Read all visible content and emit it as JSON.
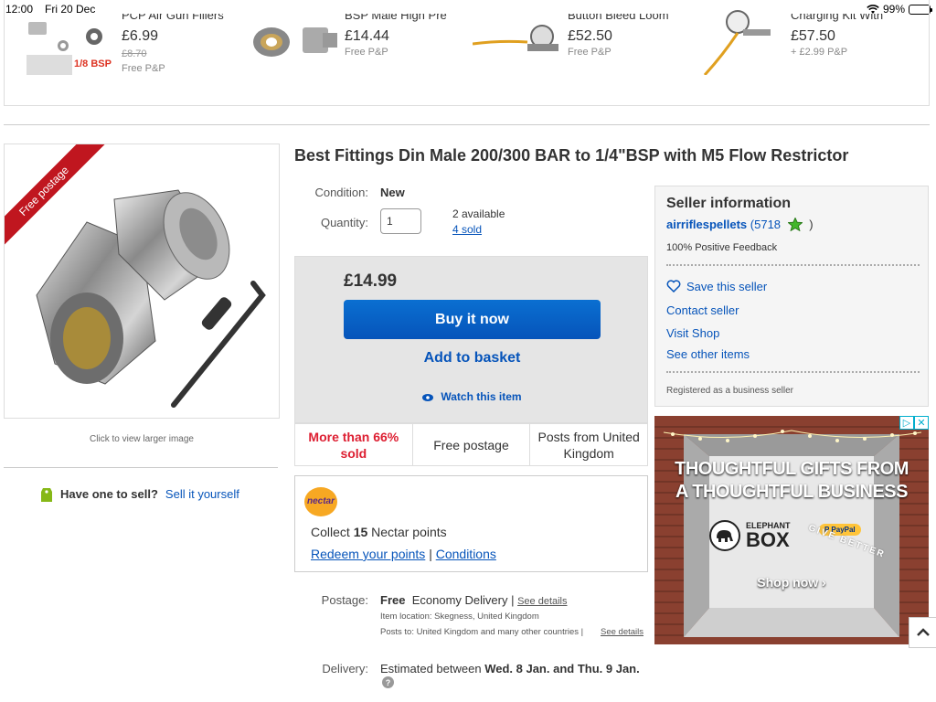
{
  "status_bar": {
    "time": "12:00",
    "date": "Fri 20 Dec",
    "battery": "99%",
    "battery_level": 0.99
  },
  "carousel": {
    "items": [
      {
        "title": "PCP Air Gun Fillers",
        "price": "£6.99",
        "was_price": "£8.70",
        "postage": "Free P&P",
        "thumb_label": "1/8 BSP"
      },
      {
        "title": "BSP Male High Pre",
        "price": "£14.44",
        "postage": "Free P&P"
      },
      {
        "title": "Button Bleed Loom",
        "price": "£52.50",
        "postage": "Free P&P"
      },
      {
        "title": "Charging Kit With",
        "price": "£57.50",
        "postage": "+ £2.99 P&P"
      }
    ]
  },
  "listing": {
    "ribbon": "Free postage",
    "click_larger": "Click to view larger image",
    "sell": {
      "question": "Have one to sell?",
      "link": "Sell it yourself"
    },
    "title": "Best Fittings Din Male 200/300 BAR to 1/4\"BSP with M5 Flow Restrictor",
    "condition_label": "Condition:",
    "condition": "New",
    "quantity_label": "Quantity:",
    "quantity_value": "1",
    "available": "2 available",
    "sold_link": "4 sold",
    "price": "£14.99",
    "buy_now": "Buy it now",
    "add_basket": "Add to basket",
    "watch": "Watch this item",
    "features": {
      "sold": "More than 66% sold",
      "postage": "Free postage",
      "posts_from": "Posts from United Kingdom"
    }
  },
  "nectar": {
    "logo": "nectar",
    "collect_prefix": "Collect",
    "points": "15",
    "collect_suffix": "Nectar points",
    "redeem": "Redeem your points",
    "separator": "|",
    "conditions": "Conditions"
  },
  "shipping": {
    "postage_label": "Postage:",
    "postage_free": "Free",
    "postage_method": "Economy Delivery |",
    "see_details": "See details",
    "item_location": "Item location:  Skegness, United Kingdom",
    "posts_to": "Posts to:  United Kingdom and many other countries |",
    "see_details2": "See details",
    "delivery_label": "Delivery:",
    "delivery_prefix": "Estimated between",
    "delivery_dates": "Wed. 8 Jan. and Thu. 9 Jan."
  },
  "seller": {
    "heading": "Seller information",
    "name": "airriflespellets",
    "score": "(5718",
    "score_close": ")",
    "feedback": "100% Positive Feedback",
    "save": "Save this seller",
    "contact": "Contact seller",
    "visit": "Visit Shop",
    "other": "See other items",
    "registered": "Registered as a business seller"
  },
  "ad": {
    "headline_1": "THOUGHTFUL GIFTS FROM",
    "headline_2": "A THOUGHTFUL BUSINESS",
    "brand_small": "ELEPHANT",
    "brand_big": "BOX",
    "paypal": "P PayPal",
    "tagline": "GIVE BETTER",
    "cta": "Shop now ›"
  }
}
